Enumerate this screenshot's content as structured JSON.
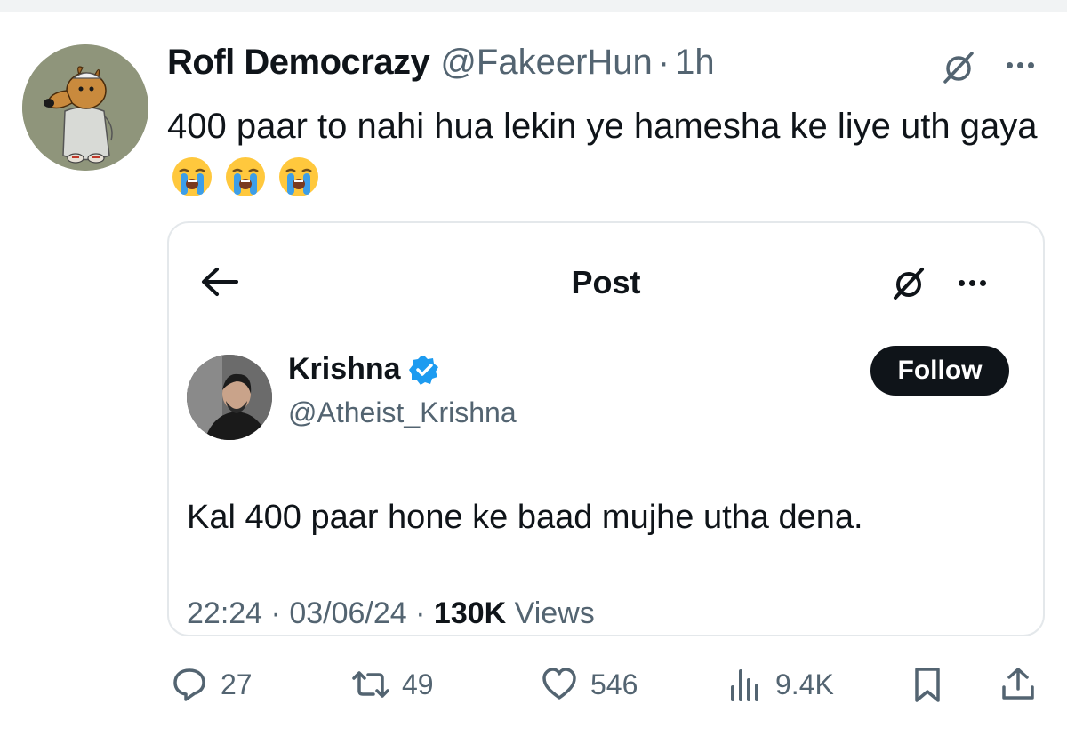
{
  "tweet": {
    "display_name": "Rofl Democrazy",
    "handle": "@FakeerHun",
    "separator": "·",
    "time": "1h",
    "text": "400 paar to nahi hua lekin ye hamesha ke liye uth gaya",
    "emojis": [
      "loudly-crying-face",
      "loudly-crying-face",
      "loudly-crying-face"
    ]
  },
  "quoted": {
    "screen_title": "Post",
    "display_name": "Krishna",
    "handle": "@Atheist_Krishna",
    "follow_label": "Follow",
    "text": "Kal 400 paar hone ke baad mujhe utha dena.",
    "time": "22:24",
    "separator": "·",
    "date": "03/06/24",
    "views_count": "130K",
    "views_label": "Views"
  },
  "actions": {
    "replies": "27",
    "reposts": "49",
    "likes": "546",
    "views": "9.4K"
  },
  "colors": {
    "text": "#0f1419",
    "muted": "#536471",
    "border": "#e4e8eb",
    "verified": "#1d9bf0",
    "emoji": "#ffc83d"
  }
}
